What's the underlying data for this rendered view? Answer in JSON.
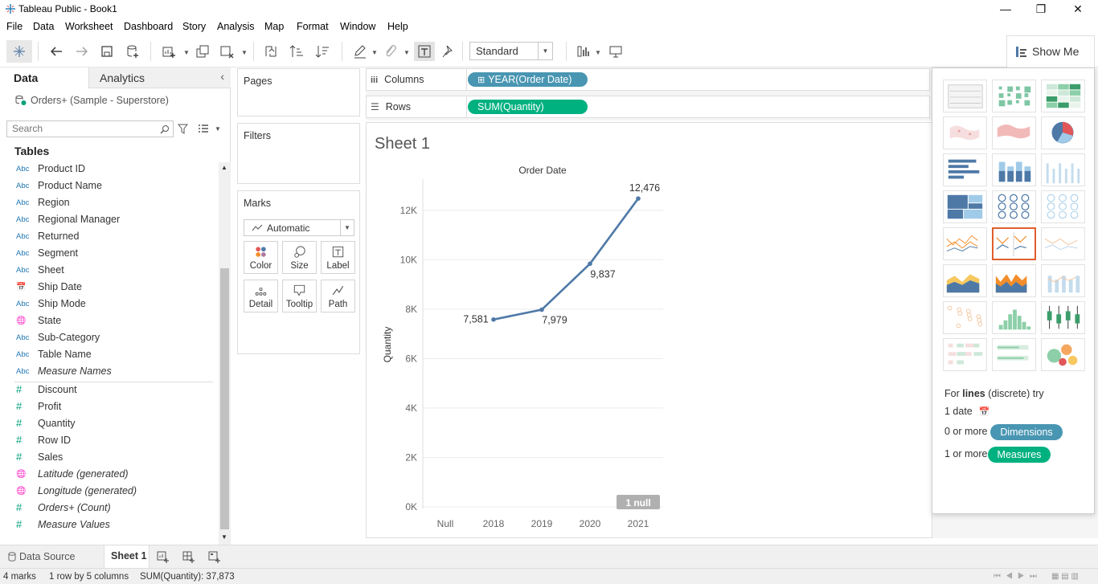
{
  "window": {
    "title": "Tableau Public - Book1",
    "minimize": "—",
    "restore": "❐",
    "close": "✕"
  },
  "menu": [
    "File",
    "Data",
    "Worksheet",
    "Dashboard",
    "Story",
    "Analysis",
    "Map",
    "Format",
    "Window",
    "Help"
  ],
  "toolbar": {
    "fit": "Standard",
    "show_me": "Show Me"
  },
  "data_pane": {
    "tab_data": "Data",
    "tab_analytics": "Analytics",
    "datasource": "Orders+ (Sample - Superstore)",
    "search_placeholder": "Search",
    "tables_heading": "Tables",
    "dimensions": [
      {
        "type": "Abc",
        "name": "Product ID"
      },
      {
        "type": "Abc",
        "name": "Product Name"
      },
      {
        "type": "Abc",
        "name": "Region"
      },
      {
        "type": "Abc",
        "name": "Regional Manager"
      },
      {
        "type": "Abc",
        "name": "Returned"
      },
      {
        "type": "Abc",
        "name": "Segment"
      },
      {
        "type": "Abc",
        "name": "Sheet"
      },
      {
        "type": "date",
        "name": "Ship Date"
      },
      {
        "type": "Abc",
        "name": "Ship Mode"
      },
      {
        "type": "geo",
        "name": "State"
      },
      {
        "type": "Abc",
        "name": "Sub-Category"
      },
      {
        "type": "Abc",
        "name": "Table Name"
      },
      {
        "type": "Abc",
        "name": "Measure Names",
        "italic": true
      }
    ],
    "measures": [
      {
        "type": "#",
        "name": "Discount"
      },
      {
        "type": "#",
        "name": "Profit"
      },
      {
        "type": "#",
        "name": "Quantity"
      },
      {
        "type": "#",
        "name": "Row ID"
      },
      {
        "type": "#",
        "name": "Sales"
      },
      {
        "type": "geo",
        "name": "Latitude (generated)",
        "italic": true
      },
      {
        "type": "geo",
        "name": "Longitude (generated)",
        "italic": true
      },
      {
        "type": "#",
        "name": "Orders+ (Count)",
        "italic": true
      },
      {
        "type": "#",
        "name": "Measure Values",
        "italic": true
      }
    ]
  },
  "cards": {
    "pages": "Pages",
    "filters": "Filters",
    "marks": "Marks",
    "mark_type": "Automatic",
    "mark_buttons": [
      "Color",
      "Size",
      "Label",
      "Detail",
      "Tooltip",
      "Path"
    ]
  },
  "shelves": {
    "columns_label": "Columns",
    "rows_label": "Rows",
    "columns_pill": "YEAR(Order Date)",
    "rows_pill": "SUM(Quantity)"
  },
  "view": {
    "sheet_title": "Sheet 1",
    "null_badge": "1 null"
  },
  "chart_data": {
    "type": "line",
    "title": "Order Date",
    "xlabel": "",
    "ylabel": "Quantity",
    "categories": [
      "Null",
      "2018",
      "2019",
      "2020",
      "2021"
    ],
    "values": [
      null,
      7581,
      7979,
      9837,
      12476
    ],
    "labels": [
      "",
      "7,581",
      "7,979",
      "9,837",
      "12,476"
    ],
    "yticks": [
      0,
      2000,
      4000,
      6000,
      8000,
      10000,
      12000
    ],
    "ytick_labels": [
      "0K",
      "2K",
      "4K",
      "6K",
      "8K",
      "10K",
      "12K"
    ],
    "ylim": [
      0,
      13000
    ],
    "line_color": "#4e79a7",
    "grid": true
  },
  "show_me": {
    "hint_prefix": "For ",
    "hint_bold": "lines",
    "hint_suffix": " (discrete) try",
    "req_date": "1 date",
    "req_dims_prefix": "0 or more",
    "req_dims_pill": "Dimensions",
    "req_meas_prefix": "1 or more",
    "req_meas_pill": "Measures",
    "dimensions_color": "#4996b2",
    "measures_color": "#00b180"
  },
  "tabs": {
    "datasource": "Data Source",
    "sheet": "Sheet 1"
  },
  "status": {
    "marks": "4 marks",
    "dims": "1 row by 5 columns",
    "sum": "SUM(Quantity): 37,873"
  }
}
